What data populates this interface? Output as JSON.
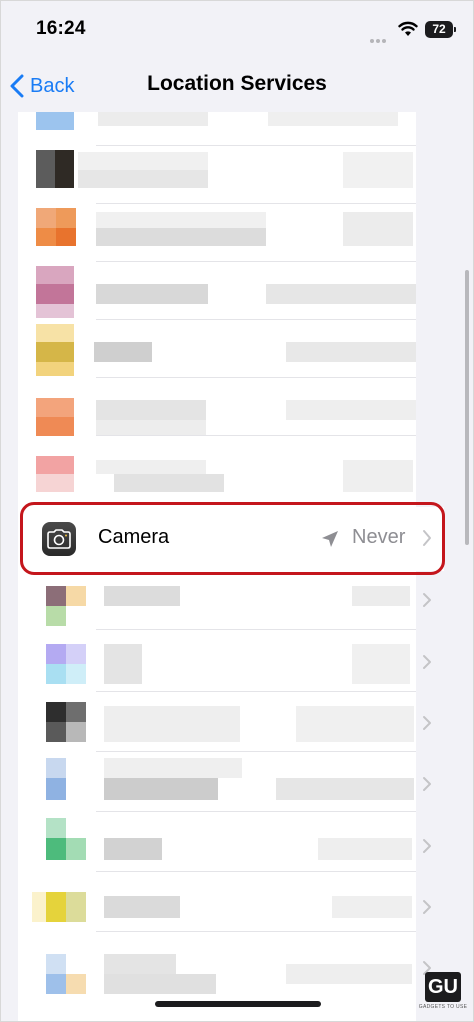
{
  "status_bar": {
    "time": "16:24",
    "battery": "72"
  },
  "nav": {
    "back_label": "Back",
    "title": "Location Services"
  },
  "highlighted_row": {
    "label": "Camera",
    "value": "Never"
  },
  "watermark": {
    "logo": "GU",
    "text": "GADGETS TO USE"
  },
  "colors": {
    "accent": "#1a7cf5",
    "highlight_border": "#c4161c",
    "secondary_text": "#8e8e93"
  },
  "icons": [
    "chevron-left-icon",
    "wifi-icon",
    "battery-icon",
    "camera-icon",
    "location-arrow-icon",
    "chevron-right-icon"
  ]
}
